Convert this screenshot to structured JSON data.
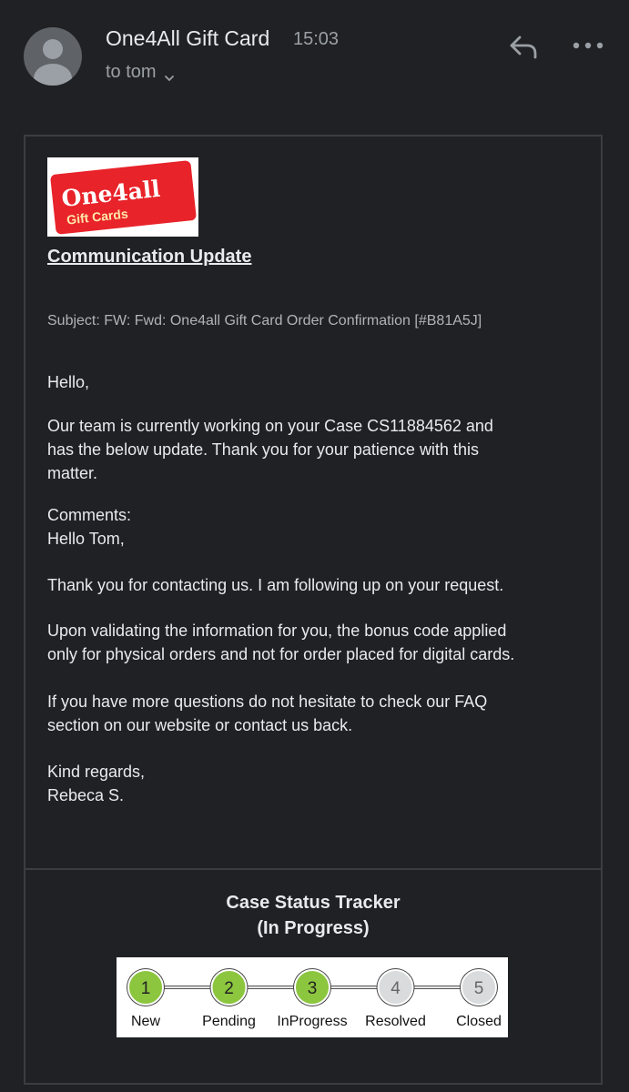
{
  "header": {
    "sender_name": "One4All Gift Card",
    "time": "15:03",
    "recipient": "to tom",
    "icons": {
      "avatar": "person-icon",
      "recipient_toggle": "chevron-down-icon",
      "reply": "reply-icon",
      "more": "more-horizontal-icon"
    }
  },
  "email": {
    "logo": {
      "line1": "One4all",
      "line2": "Gift Cards",
      "brand_color": "#e8232a"
    },
    "title": "Communication Update",
    "subject": "Subject: FW: Fwd: One4all Gift Card Order Confirmation [#B81A5J]",
    "greeting": "Hello,",
    "intro_lines": [
      "Our team is currently working on your Case CS11884562 and",
      "has the below update. Thank you for your patience with this",
      "matter."
    ],
    "comments_label": "Comments:",
    "comments_greeting": "Hello Tom,",
    "thanks_line": "Thank you for contacting us. I am following up on your request.",
    "validation_lines": [
      "Upon validating the information for you, the bonus code applied",
      "only for physical orders and not for order placed for digital cards."
    ],
    "faq_lines": [
      "If you have more questions do not hesitate to check our FAQ",
      "section on our website or contact us back."
    ],
    "signoff": "Kind regards,",
    "signature": "Rebeca S."
  },
  "tracker": {
    "title_line1": "Case Status Tracker",
    "title_line2": "(In Progress)",
    "completed_color": "#8cc63f",
    "pending_color": "#d9dbdc",
    "steps": [
      {
        "number": "1",
        "label": "New",
        "complete": true
      },
      {
        "number": "2",
        "label": "Pending",
        "complete": true
      },
      {
        "number": "3",
        "label": "InProgress",
        "complete": true
      },
      {
        "number": "4",
        "label": "Resolved",
        "complete": false
      },
      {
        "number": "5",
        "label": "Closed",
        "complete": false
      }
    ]
  }
}
